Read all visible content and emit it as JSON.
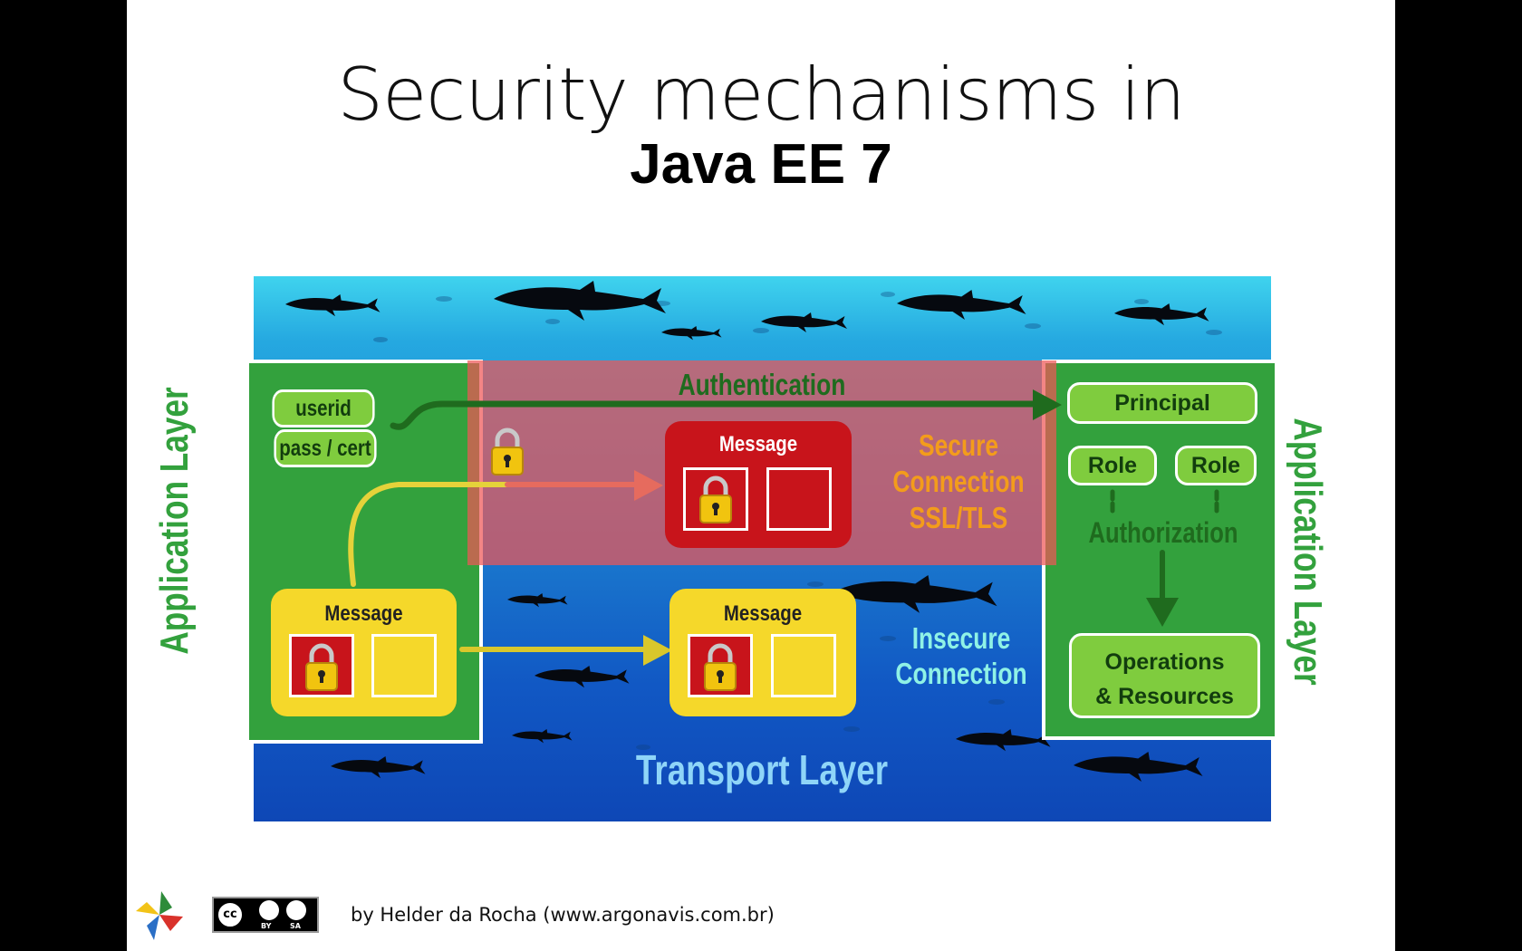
{
  "title": {
    "line1": "Security mechanisms in",
    "line2": "Java EE 7"
  },
  "diagram": {
    "authentication": "Authentication",
    "userid": "userid",
    "pass_cert": "pass / cert",
    "message_secure": "Message",
    "message_left": "Message",
    "message_insecure": "Message",
    "secure_connection": [
      "Secure",
      "Connection",
      "SSL/TLS"
    ],
    "insecure_connection": [
      "Insecure",
      "Connection"
    ],
    "principal": "Principal",
    "role1": "Role",
    "role2": "Role",
    "authorization": "Authorization",
    "operations": [
      "Operations",
      "& Resources"
    ],
    "application_layer_left": "Application Layer",
    "application_layer_right": "Application Layer",
    "transport_layer": "Transport Layer"
  },
  "footer": {
    "credit": "by Helder da Rocha (www.argonavis.com.br)",
    "license_small": [
      "BY",
      "SA"
    ]
  },
  "colors": {
    "green_panel": "#33a13d",
    "green_button": "#7fcc3e",
    "secure_red": "#e04848",
    "message_red": "#c8141b",
    "message_yellow": "#f5d82a",
    "orange_text": "#f39c1b",
    "cyan_text": "#8ff2e6",
    "transport_text": "#8fd5f8"
  }
}
